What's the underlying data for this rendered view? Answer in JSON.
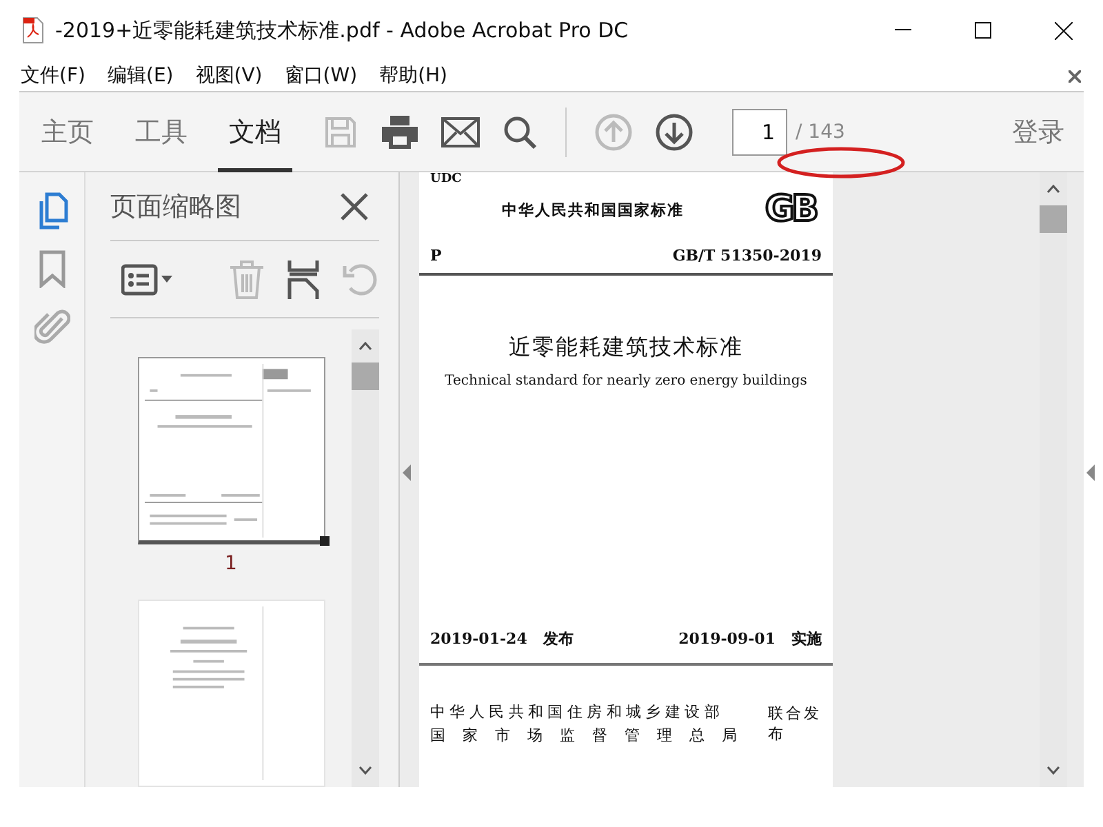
{
  "window": {
    "title": "-2019+近零能耗建筑技术标准.pdf - Adobe Acrobat Pro DC"
  },
  "menu": [
    "文件(F)",
    "编辑(E)",
    "视图(V)",
    "窗口(W)",
    "帮助(H)"
  ],
  "toolbar": {
    "tabs": [
      {
        "label": "主页",
        "selected": false
      },
      {
        "label": "工具",
        "selected": false
      },
      {
        "label": "文档",
        "selected": true
      }
    ],
    "tools": [
      {
        "kind": "save",
        "disabled": true
      },
      {
        "kind": "print",
        "disabled": false
      },
      {
        "kind": "mail",
        "disabled": false
      },
      {
        "kind": "search",
        "disabled": false
      }
    ],
    "nav": [
      {
        "kind": "up",
        "disabled": true
      },
      {
        "kind": "down",
        "disabled": false
      }
    ],
    "page_input": "1",
    "page_total": "/ 143",
    "sign_in": "登录"
  },
  "rail": [
    {
      "kind": "pages",
      "selected": true
    },
    {
      "kind": "bookmark",
      "selected": false
    },
    {
      "kind": "attachment",
      "selected": false
    }
  ],
  "sidebar": {
    "title": "页面缩略图",
    "tools": [
      {
        "kind": "options",
        "disabled": false
      },
      {
        "kind": "delete",
        "disabled": true
      },
      {
        "kind": "extract",
        "disabled": false
      },
      {
        "kind": "rotate",
        "disabled": true
      }
    ],
    "thumbnails": [
      {
        "kind": "cover",
        "label": "1",
        "selected": true
      },
      {
        "kind": "inner",
        "selected": false
      }
    ]
  },
  "document": {
    "udc": "UDC",
    "issuer": "中华人民共和国国家标准",
    "logo": "GB",
    "class_code": "P",
    "number": "GB/T 51350-2019",
    "title_zh": "近零能耗建筑技术标准",
    "title_en": "Technical standard for nearly zero energy buildings",
    "publish_date": "2019-01-24",
    "publish_label": "发布",
    "effective_date": "2019-09-01",
    "effective_label": "实施",
    "authorities": [
      "中华人民共和国住房和城乡建设部",
      "国家市场监督管理总局"
    ],
    "joint_label": "联合发布"
  }
}
